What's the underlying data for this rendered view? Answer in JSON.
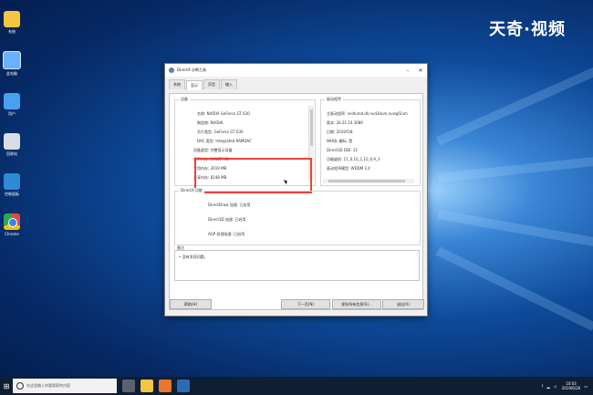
{
  "watermark": "天奇·视频",
  "desktop_icons": [
    {
      "name": "folder",
      "label": "系统"
    },
    {
      "name": "computer",
      "label": "此电脑"
    },
    {
      "name": "user",
      "label": "用户"
    },
    {
      "name": "recycle-bin",
      "label": "回收站"
    },
    {
      "name": "network",
      "label": "控制面板"
    },
    {
      "name": "chrome",
      "label": "Chrome"
    }
  ],
  "dialog": {
    "title": "DirectX 诊断工具",
    "tabs": [
      "系统",
      "显示",
      "声音",
      "输入"
    ],
    "device_group_label": "设备",
    "device_rows": [
      "名称: NVIDIA GeForce GT 630",
      "制造商: NVIDIA",
      "芯片类型: GeForce GT 630",
      "DAC 类型: Integrated RAMDAC",
      "设备类型: 完整显示设备",
      "显示内存: 10167 MB",
      "专用内存: 2019 MB",
      "共享内存: 8148 MB"
    ],
    "driver_group_label": "驱动程序",
    "driver_rows": [
      "主驱动程序: nvldumd.dll,nvd3dum,nvwgf2um",
      "版本: 26.21.14.3086",
      "日期: 2019/5/8",
      "WHQL 徽标: 是",
      "Direct3D DDI: 12",
      "功能级别: 11_0,10_1,10_0,9_3",
      "驱动程序模型: WDDM 2.4"
    ],
    "directx_group_label": "DirectX 功能",
    "directx_rows": [
      "DirectDraw 加速: 已启用",
      "Direct3D 加速: 已启用",
      "AGP 纹理加速: 已启用"
    ],
    "notes_group_label": "备注",
    "notes_text": "• 没有发现问题。",
    "buttons": {
      "help": "帮助(H)",
      "next": "下一页(N)",
      "save": "保存所有信息(S)...",
      "exit": "退出(X)"
    }
  },
  "taskbar": {
    "search_placeholder": "在这里输入你要搜索的内容",
    "time": "10:03",
    "date": "2019/6/26"
  }
}
